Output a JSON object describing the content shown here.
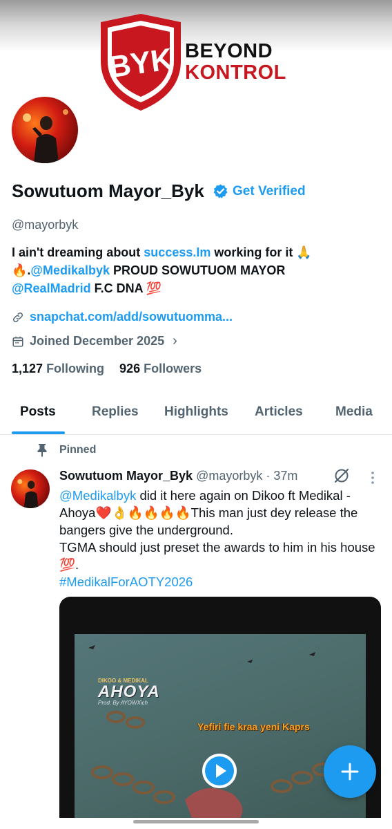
{
  "banner": {
    "logo_monogram": "BYK",
    "brand_line1": "BEYOND",
    "brand_line2": "KONTROL"
  },
  "profile": {
    "name": "Sowutuom Mayor_Byk",
    "get_verified": "Get Verified",
    "handle": "@mayorbyk",
    "bio": {
      "part1": "I ain't dreaming about ",
      "link1": "success.Im",
      "part2": " working for it 🙏",
      "part3": "🔥.",
      "mention1": "@Medikalbyk",
      "part4": " PROUD SOWUTUOM MAYOR",
      "mention2": "@RealMadrid",
      "part5": " F.C DNA 💯"
    },
    "website": "snapchat.com/add/sowutuomma...",
    "joined": "Joined December 2025",
    "following_count": "1,127",
    "following_label": "Following",
    "followers_count": "926",
    "followers_label": "Followers"
  },
  "tabs": [
    "Posts",
    "Replies",
    "Highlights",
    "Articles",
    "Media"
  ],
  "active_tab": "Posts",
  "post": {
    "pinned_label": "Pinned",
    "author_name": "Sowutuom Mayor_Byk",
    "author_handle": "@mayorbyk",
    "time": "· 37m",
    "mention": "@Medikalbyk",
    "text1": " did it here again on Dikoo ft Medikal -Ahoya❤️👌🔥🔥🔥🔥This man just dey release the bangers give the underground.",
    "text2": "TGMA should just preset the awards to him in his house 💯.",
    "hashtag": "#MedikalForAOTY2026",
    "media": {
      "credits": "DIKOO & MEDIKAL",
      "title": "AHOYA",
      "prod": "Prod. By AYOWXich",
      "lyric": "Yefiri fie kraa yeni Kaprs"
    }
  },
  "colors": {
    "accent": "#1d9bf0",
    "text": "#0f1419",
    "muted": "#536471",
    "brand_red": "#c8171e"
  },
  "icons": [
    "verified-icon",
    "link-icon",
    "calendar-icon",
    "chevron-right-icon",
    "pin-icon",
    "grok-icon",
    "more-icon",
    "play-icon",
    "plus-icon"
  ]
}
